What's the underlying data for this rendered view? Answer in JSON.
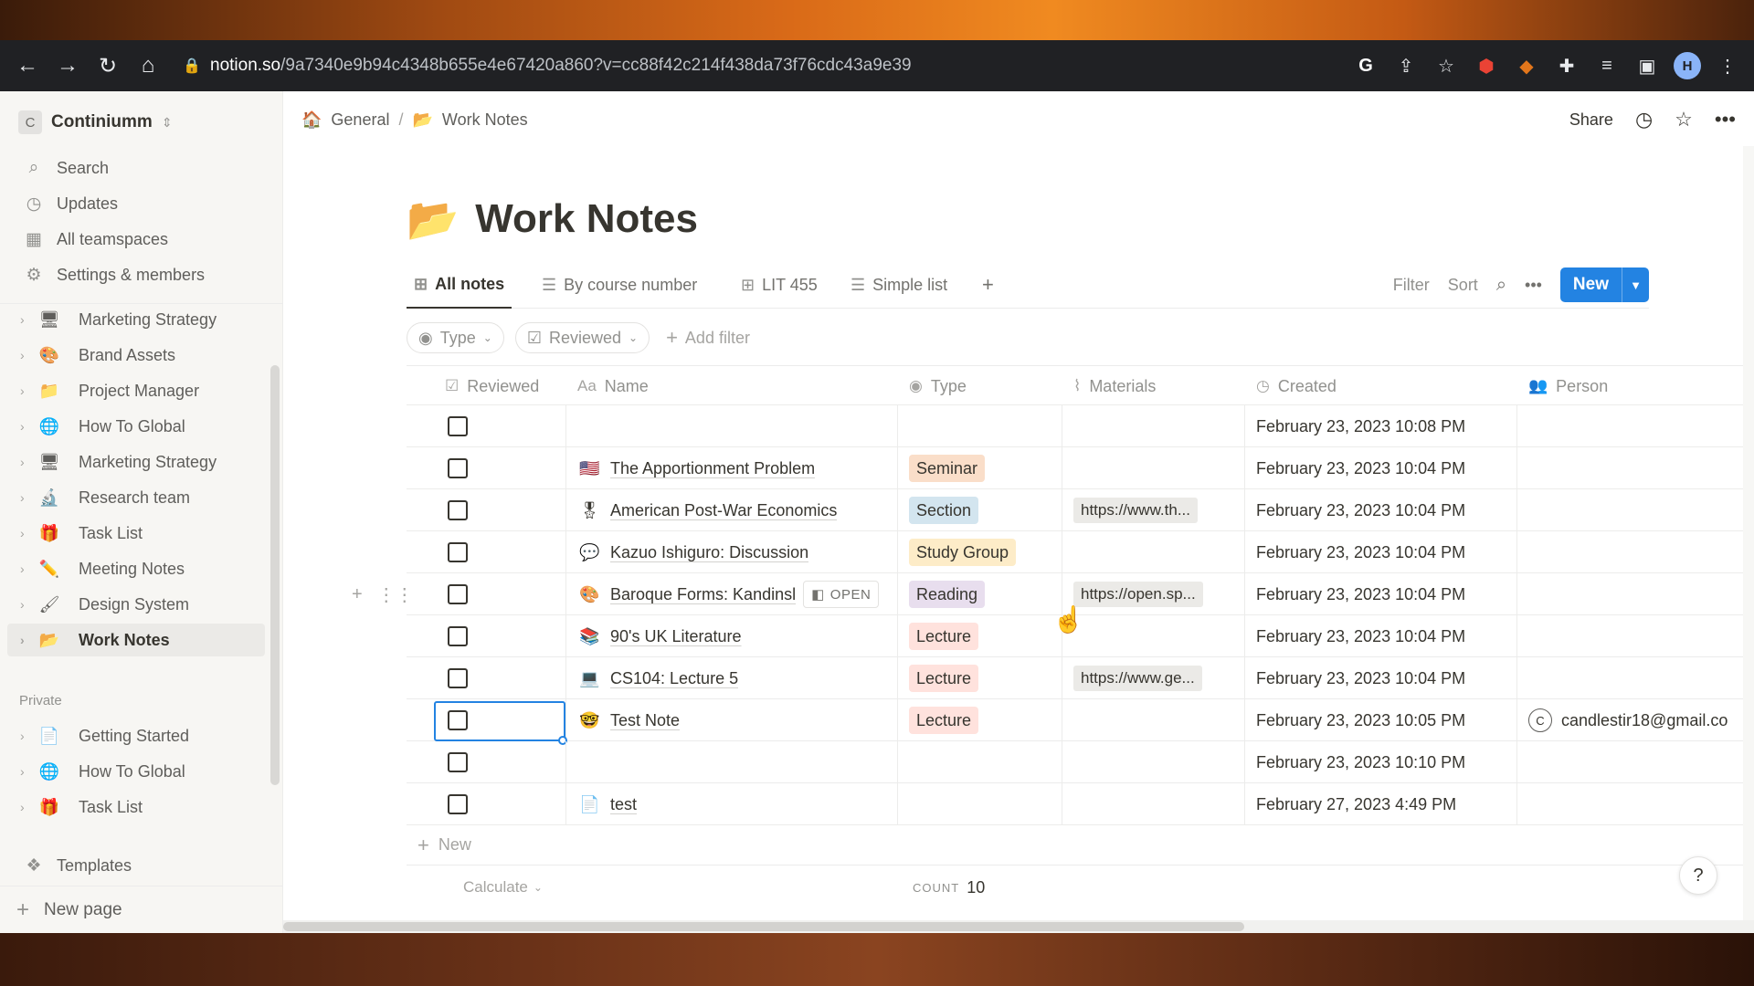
{
  "browser": {
    "url_domain": "notion.so",
    "url_path": "/9a7340e9b94c4348b655e4e67420a860?v=cc88f42c214f438da73f76cdc43a9e39",
    "profile_initial": "H"
  },
  "sidebar": {
    "workspace_badge": "C",
    "workspace_name": "Continiumm",
    "menu": [
      {
        "label": "Search",
        "icon": "search-icon"
      },
      {
        "label": "Updates",
        "icon": "clock-icon"
      },
      {
        "label": "All teamspaces",
        "icon": "grid-icon"
      },
      {
        "label": "Settings & members",
        "icon": "gear-icon"
      }
    ],
    "pages": [
      {
        "label": "Marketing Strategy",
        "emoji": "🖥"
      },
      {
        "label": "Brand Assets",
        "emoji": "🎨"
      },
      {
        "label": "Project Manager",
        "emoji": "📁"
      },
      {
        "label": "How To Global",
        "emoji": "🌐"
      },
      {
        "label": "Marketing Strategy",
        "emoji": "🖥"
      },
      {
        "label": "Research team",
        "emoji": "🔬"
      },
      {
        "label": "Task List",
        "emoji": "🎁"
      },
      {
        "label": "Meeting Notes",
        "emoji": "✏️"
      },
      {
        "label": "Design System",
        "emoji": "🖌"
      },
      {
        "label": "Work Notes",
        "emoji": "📂",
        "active": true
      }
    ],
    "private_label": "Private",
    "private_pages": [
      {
        "label": "Getting Started",
        "emoji": "📄"
      },
      {
        "label": "How To Global",
        "emoji": "🌐"
      },
      {
        "label": "Task List",
        "emoji": "🎁"
      }
    ],
    "templates_label": "Templates",
    "new_page_label": "New page"
  },
  "topbar": {
    "breadcrumb_root": "General",
    "breadcrumb_sep": "/",
    "breadcrumb_current": "Work Notes",
    "share_label": "Share"
  },
  "page": {
    "title": "Work Notes",
    "title_emoji": "📂"
  },
  "views": {
    "tabs": [
      {
        "label": "All notes",
        "icon": "table-icon"
      },
      {
        "label": "By course number",
        "icon": "list-icon"
      },
      {
        "label": "LIT 455",
        "icon": "table-icon"
      },
      {
        "label": "Simple list",
        "icon": "list-icon"
      }
    ],
    "add_view": "+",
    "filter_label": "Filter",
    "sort_label": "Sort",
    "new_label": "New"
  },
  "filters": {
    "chips": [
      "Type",
      "Reviewed"
    ],
    "add_filter": "Add filter"
  },
  "table": {
    "columns": {
      "reviewed": "Reviewed",
      "name": "Name",
      "name_prefix": "Aa",
      "type": "Type",
      "materials": "Materials",
      "created": "Created",
      "person": "Person"
    },
    "rows": [
      {
        "name": "",
        "emoji": "",
        "type": "",
        "materials": "",
        "created": "February 23, 2023 10:08 PM",
        "person": ""
      },
      {
        "name": "The Apportionment Problem",
        "emoji": "🇺🇸",
        "type": "Seminar",
        "materials": "",
        "created": "February 23, 2023 10:04 PM",
        "person": ""
      },
      {
        "name": "American Post-War Economics",
        "emoji": "🎖",
        "type": "Section",
        "materials": "https://www.th...",
        "created": "February 23, 2023 10:04 PM",
        "person": ""
      },
      {
        "name": "Kazuo Ishiguro: Discussion",
        "emoji": "💬",
        "type": "Study Group",
        "materials": "",
        "created": "February 23, 2023 10:04 PM",
        "person": ""
      },
      {
        "name": "Baroque Forms: Kandinsl",
        "emoji": "🎨",
        "type": "Reading",
        "materials": "https://open.sp...",
        "created": "February 23, 2023 10:04 PM",
        "person": "",
        "open_label": "OPEN"
      },
      {
        "name": "90's UK Literature",
        "emoji": "📚",
        "type": "Lecture",
        "materials": "",
        "created": "February 23, 2023 10:04 PM",
        "person": ""
      },
      {
        "name": "CS104: Lecture 5",
        "emoji": "💻",
        "type": "Lecture",
        "materials": "https://www.ge...",
        "created": "February 23, 2023 10:04 PM",
        "person": ""
      },
      {
        "name": "Test Note",
        "emoji": "🤓",
        "type": "Lecture",
        "materials": "",
        "created": "February 23, 2023 10:05 PM",
        "person": "candlestir18@gmail.co",
        "person_initial": "C"
      },
      {
        "name": "",
        "emoji": "",
        "type": "",
        "materials": "",
        "created": "February 23, 2023 10:10 PM",
        "person": ""
      },
      {
        "name": "test",
        "emoji": "📄",
        "type": "",
        "materials": "",
        "created": "February 27, 2023 4:49 PM",
        "person": ""
      }
    ],
    "new_row_label": "New",
    "calculate_label": "Calculate",
    "count_label": "COUNT",
    "count_value": "10"
  },
  "tag_colors": {
    "Seminar": "#fadec9",
    "Section": "#d3e5ef",
    "Study Group": "#fdecc8",
    "Reading": "#e8deee",
    "Lecture": "#ffe2dd"
  },
  "help_label": "?"
}
